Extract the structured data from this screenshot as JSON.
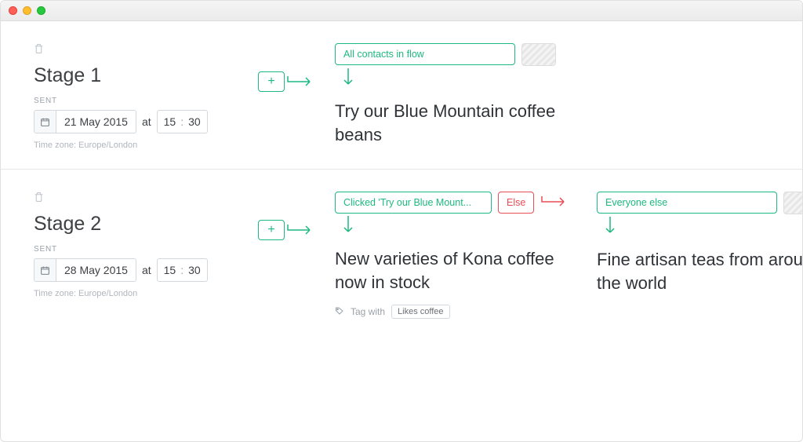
{
  "stages": [
    {
      "title": "Stage 1",
      "sentLabel": "SENT",
      "date": "21 May 2015",
      "atText": "at",
      "hour": "15",
      "minute": "30",
      "timezone": "Time zone: Europe/London",
      "columns": [
        {
          "pill": "All contacts in flow",
          "hasHatch": true,
          "subject": "Try our Blue Mountain coffee beans"
        }
      ]
    },
    {
      "title": "Stage 2",
      "sentLabel": "SENT",
      "date": "28 May 2015",
      "atText": "at",
      "hour": "15",
      "minute": "30",
      "timezone": "Time zone: Europe/London",
      "columns": [
        {
          "pill": "Clicked 'Try our Blue Mount...",
          "hasElse": true,
          "elseLabel": "Else",
          "subject": "New varieties of Kona coffee now in stock",
          "tagLabel": "Tag with",
          "tagValue": "Likes coffee"
        },
        {
          "pill": "Everyone else",
          "hasHatch": true,
          "subject": "Fine artisan teas from around the world"
        }
      ]
    }
  ]
}
